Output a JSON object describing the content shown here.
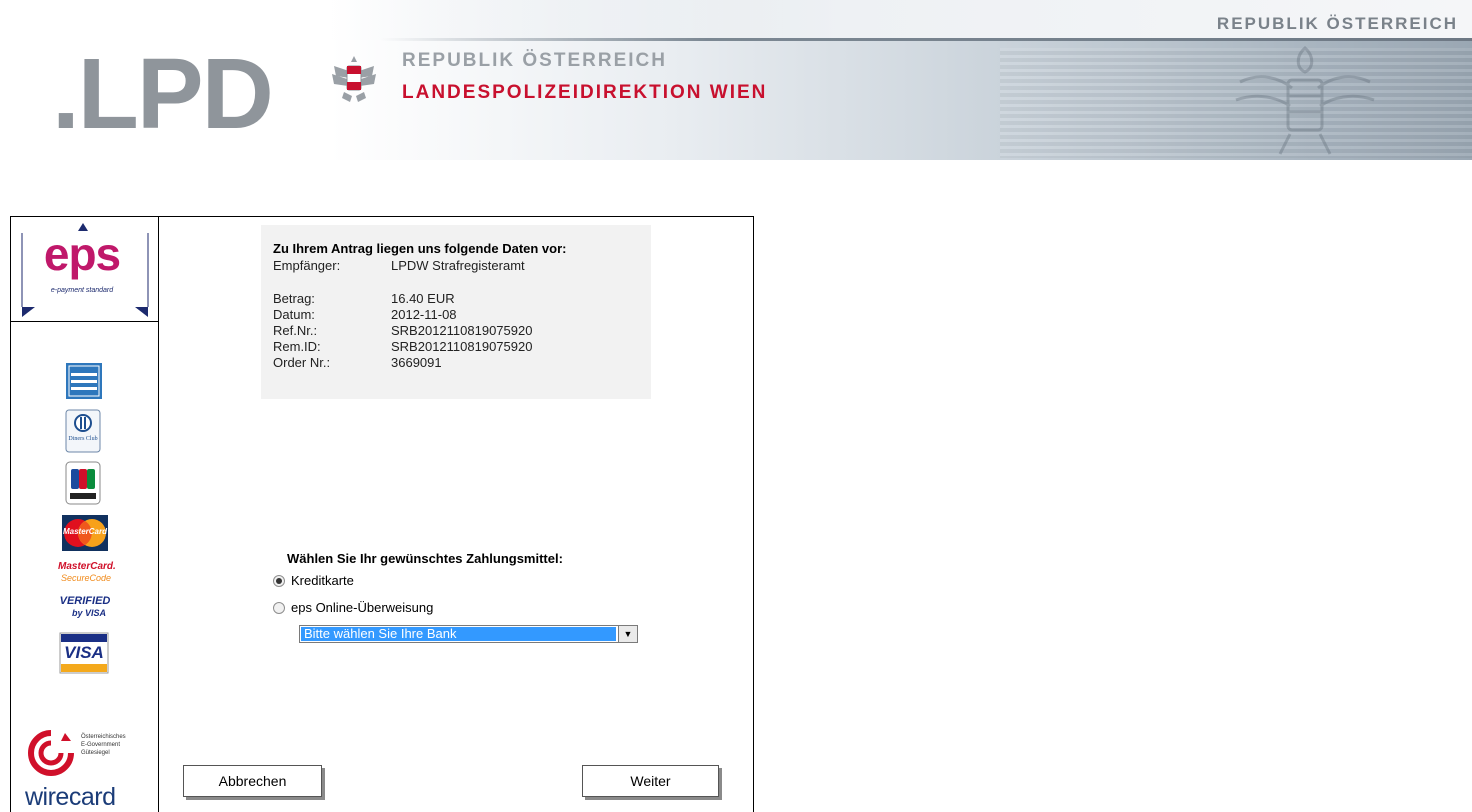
{
  "header": {
    "logo_text": ".LPD",
    "republic_line": "REPUBLIK ÖSTERREICH",
    "authority_line": "LANDESPOLIZEIDIREKTION WIEN",
    "top_right": "REPUBLIK ÖSTERREICH"
  },
  "sidebar": {
    "eps_logo": "eps",
    "eps_tagline": "e-payment standard",
    "cards": [
      "american-express",
      "diners-club",
      "jcb",
      "mastercard",
      "mastercard-securecode",
      "verified-by-visa",
      "visa"
    ],
    "diners_text": "Diners Club",
    "mc_text": "MasterCard",
    "mc_secure_1": "MasterCard.",
    "mc_secure_2": "SecureCode",
    "vbv_1": "VERIFIED",
    "vbv_2": "by VISA",
    "visa_text": "VISA",
    "egov_text": "Österreichisches E-Government Gütesiegel",
    "wirecard": "wirecard"
  },
  "info": {
    "title": "Zu Ihrem Antrag liegen uns folgende Daten vor:",
    "rows": [
      {
        "label": "Empfänger:",
        "value": "LPDW Strafregisteramt"
      },
      {
        "label": "Betrag:",
        "value": "16.40 EUR"
      },
      {
        "label": "Datum:",
        "value": "2012-11-08"
      },
      {
        "label": "Ref.Nr.:",
        "value": "SRB2012110819075920"
      },
      {
        "label": "Rem.ID:",
        "value": "SRB2012110819075920"
      },
      {
        "label": "Order Nr.:",
        "value": "3669091"
      }
    ]
  },
  "payment": {
    "prompt": "Wählen Sie Ihr gewünschtes Zahlungsmittel:",
    "option_card": "Kreditkarte",
    "option_eps": "eps Online-Überweisung",
    "selected": "Kreditkarte",
    "bank_select": "Bitte wählen Sie Ihre Bank"
  },
  "buttons": {
    "cancel": "Abbrechen",
    "next": "Weiter"
  },
  "colors": {
    "accent_red": "#c8102e",
    "eps_magenta": "#c0186a",
    "select_highlight": "#3399ff"
  }
}
